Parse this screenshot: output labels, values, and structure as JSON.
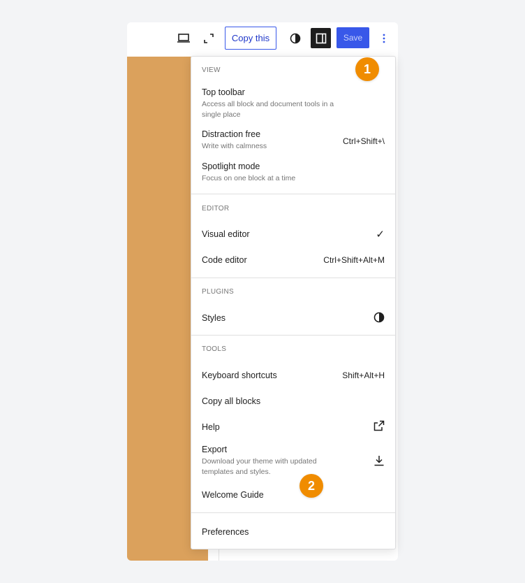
{
  "toolbar": {
    "copy_label": "Copy this",
    "save_label": "Save"
  },
  "menu": {
    "view": {
      "title": "VIEW",
      "items": [
        {
          "label": "Top toolbar",
          "desc": "Access all block and document tools in a single place"
        },
        {
          "label": "Distraction free",
          "desc": "Write with calmness",
          "shortcut": "Ctrl+Shift+\\"
        },
        {
          "label": "Spotlight mode",
          "desc": "Focus on one block at a time"
        }
      ]
    },
    "editor": {
      "title": "EDITOR",
      "items": [
        {
          "label": "Visual editor",
          "check": "✓"
        },
        {
          "label": "Code editor",
          "shortcut": "Ctrl+Shift+Alt+M"
        }
      ]
    },
    "plugins": {
      "title": "PLUGINS",
      "items": [
        {
          "label": "Styles",
          "icon": "half-circle-icon"
        }
      ]
    },
    "tools": {
      "title": "TOOLS",
      "items": [
        {
          "label": "Keyboard shortcuts",
          "shortcut": "Shift+Alt+H"
        },
        {
          "label": "Copy all blocks"
        },
        {
          "label": "Help",
          "icon": "external-link-icon"
        },
        {
          "label": "Export",
          "desc": "Download your theme with updated templates and styles.",
          "icon": "download-icon"
        },
        {
          "label": "Welcome Guide"
        }
      ]
    },
    "preferences": {
      "label": "Preferences"
    }
  },
  "badges": [
    "1",
    "2"
  ],
  "colors": {
    "accent": "#3858e9",
    "canvas": "#dba15c",
    "badge": "#f08c00"
  }
}
